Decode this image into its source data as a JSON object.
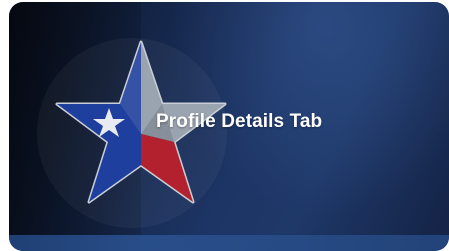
{
  "card": {
    "title": "Profile Details Tab"
  },
  "icons": {
    "star": "texas-star-icon"
  },
  "colors": {
    "background_dark": "#0b1222",
    "background_blue": "#1d3565",
    "star_blue": "#1f3f9e",
    "star_red": "#b3202e",
    "star_gray": "#9aa3b0",
    "title_text": "#ffffff"
  }
}
